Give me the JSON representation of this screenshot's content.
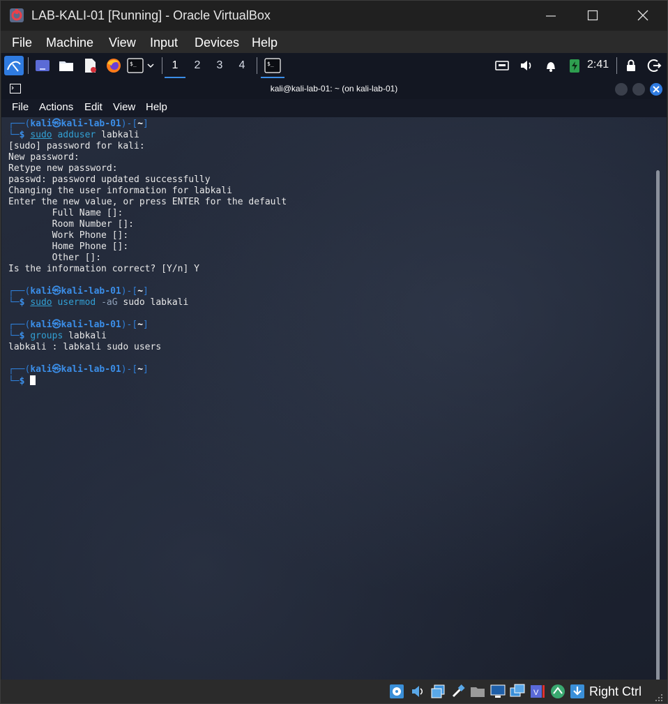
{
  "host": {
    "window_title": "LAB-KALI-01 [Running] - Oracle VirtualBox",
    "menu": [
      "File",
      "Machine",
      "View",
      "Input",
      "Devices",
      "Help"
    ],
    "host_key": "Right Ctrl"
  },
  "panel": {
    "workspaces": [
      "1",
      "2",
      "3",
      "4"
    ],
    "active_workspace": "1",
    "clock": "2:41",
    "terminal_glyph": "$_"
  },
  "terminal": {
    "title": "kali@kali-lab-01: ~ (on kali-lab-01)",
    "menu": [
      "File",
      "Actions",
      "Edit",
      "View",
      "Help"
    ],
    "prompt": {
      "top_left": "┌──(",
      "user": "kali",
      "at": "㉿",
      "host": "kali-lab-01",
      "mid": ")-[",
      "dir": "~",
      "close": "]",
      "bottom_left": "└─",
      "dollar": "$"
    },
    "commands": [
      {
        "sudo": "sudo",
        "cmd": "adduser",
        "args": " labkali"
      },
      {
        "sudo": "sudo",
        "cmd": "usermod",
        "opt": " -aG",
        "args": " sudo labkali"
      },
      {
        "sudo": "",
        "cmd": "groups",
        "args": " labkali"
      }
    ],
    "output1": [
      "[sudo] password for kali:",
      "New password:",
      "Retype new password:",
      "passwd: password updated successfully",
      "Changing the user information for labkali",
      "Enter the new value, or press ENTER for the default",
      "        Full Name []:",
      "        Room Number []:",
      "        Work Phone []:",
      "        Home Phone []:",
      "        Other []:",
      "Is the information correct? [Y/n] Y"
    ],
    "output3": [
      "labkali : labkali sudo users"
    ]
  }
}
